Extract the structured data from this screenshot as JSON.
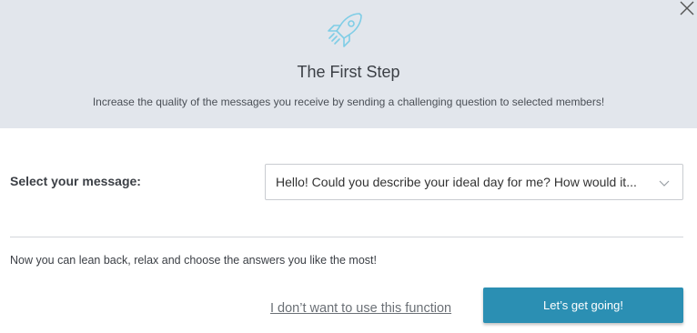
{
  "colors": {
    "header_bg": "#e2e6ec",
    "accent": "#2b8fb3",
    "rocket": "#7fcde6"
  },
  "header": {
    "icon": "rocket-icon",
    "close_icon": "close-icon",
    "title": "The First Step",
    "subtitle": "Increase the quality of the messages you receive by sending a challenging question to selected members!"
  },
  "form": {
    "select_label": "Select your message:",
    "select_value": "Hello! Could you describe your ideal day for me? How would it...",
    "select_icon": "chevron-down-icon"
  },
  "footer": {
    "hint": "Now you can lean back, relax and choose the answers you like the most!",
    "skip_link": "I don’t want to use this function",
    "primary_button": "Let’s get going!"
  }
}
